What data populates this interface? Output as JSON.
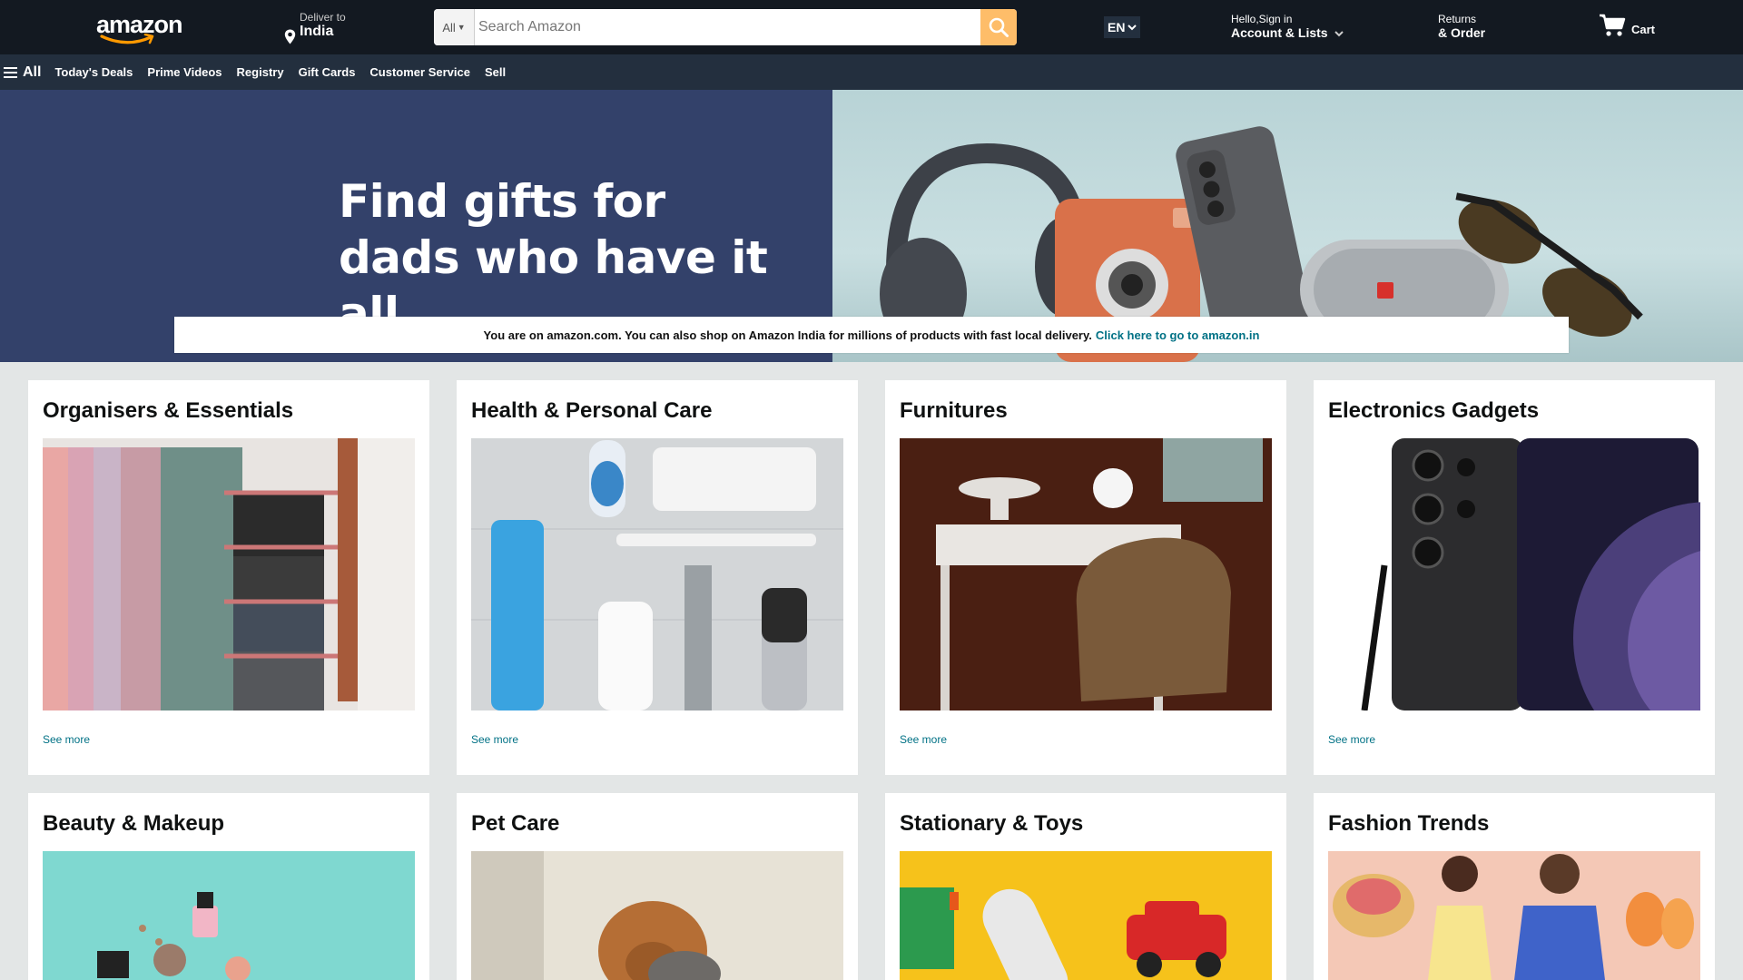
{
  "header": {
    "logo_text": "amazon",
    "deliver_line1": "Deliver to",
    "deliver_line2": "India",
    "search_category": "All",
    "search_placeholder": "Search Amazon",
    "language": "EN",
    "account_line1": "Hello,Sign in",
    "account_line2": "Account & Lists",
    "returns_line1": "Returns",
    "returns_line2": "& Order",
    "cart_label": "Cart"
  },
  "subnav": {
    "all_label": "All",
    "items": [
      "Today's Deals",
      "Prime Videos",
      "Registry",
      "Gift Cards",
      "Customer Service",
      "Sell"
    ]
  },
  "hero": {
    "title_line1": "Find gifts for",
    "title_line2": "dads who have it all"
  },
  "notice": {
    "text": "You are on amazon.com. You can also shop on Amazon India for millions of products with fast local delivery.",
    "link": "Click here to go to amazon.in"
  },
  "cards": [
    {
      "title": "Organisers & Essentials",
      "link": "See more"
    },
    {
      "title": "Health & Personal Care",
      "link": "See more"
    },
    {
      "title": "Furnitures",
      "link": "See more"
    },
    {
      "title": "Electronics Gadgets",
      "link": "See more"
    },
    {
      "title": "Beauty & Makeup",
      "link": ""
    },
    {
      "title": "Pet Care",
      "link": ""
    },
    {
      "title": "Stationary & Toys",
      "link": ""
    },
    {
      "title": "Fashion Trends",
      "link": ""
    }
  ],
  "colors": {
    "nav_bg": "#131921",
    "subnav_bg": "#232f3e",
    "search_button": "#febd69",
    "link": "#007185",
    "hero_left": "#33416a",
    "page_bg": "#e3e6e6"
  },
  "icons": [
    "location-pin-icon",
    "search-icon",
    "chevron-down-icon",
    "cart-icon",
    "hamburger-icon"
  ]
}
